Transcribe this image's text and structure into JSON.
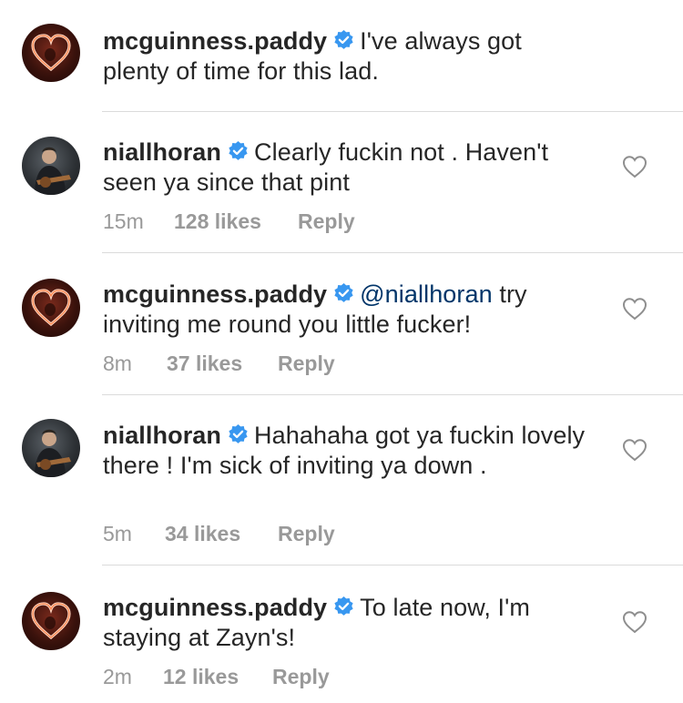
{
  "comments": [
    {
      "username": "mcguinness.paddy",
      "verified": true,
      "avatar": "heart-neon-avatar",
      "text": "I've always got plenty of time for this lad.",
      "time": "",
      "likes": "",
      "reply": ""
    },
    {
      "username": "niallhoran",
      "verified": true,
      "avatar": "guitar-avatar",
      "text": "Clearly fuckin not . Haven't seen ya since that pint",
      "time": "15m",
      "likes": "128 likes",
      "reply": "Reply"
    },
    {
      "username": "mcguinness.paddy",
      "verified": true,
      "avatar": "heart-neon-avatar",
      "mention": "@niallhoran",
      "text": "try inviting me round you little fucker!",
      "time": "8m",
      "likes": "37 likes",
      "reply": "Reply"
    },
    {
      "username": "niallhoran",
      "verified": true,
      "avatar": "guitar-avatar",
      "text": "Hahahaha got ya fuckin lovely there ! I'm sick of inviting ya down .",
      "time": "5m",
      "likes": "34 likes",
      "reply": "Reply"
    },
    {
      "username": "mcguinness.paddy",
      "verified": true,
      "avatar": "heart-neon-avatar",
      "text": "To late now, I'm staying at Zayn's!",
      "time": "2m",
      "likes": "12 likes",
      "reply": "Reply"
    }
  ],
  "colors": {
    "verified": "#3897f0",
    "meta": "#999999",
    "text": "#262626",
    "divider": "#dbdbdb"
  }
}
